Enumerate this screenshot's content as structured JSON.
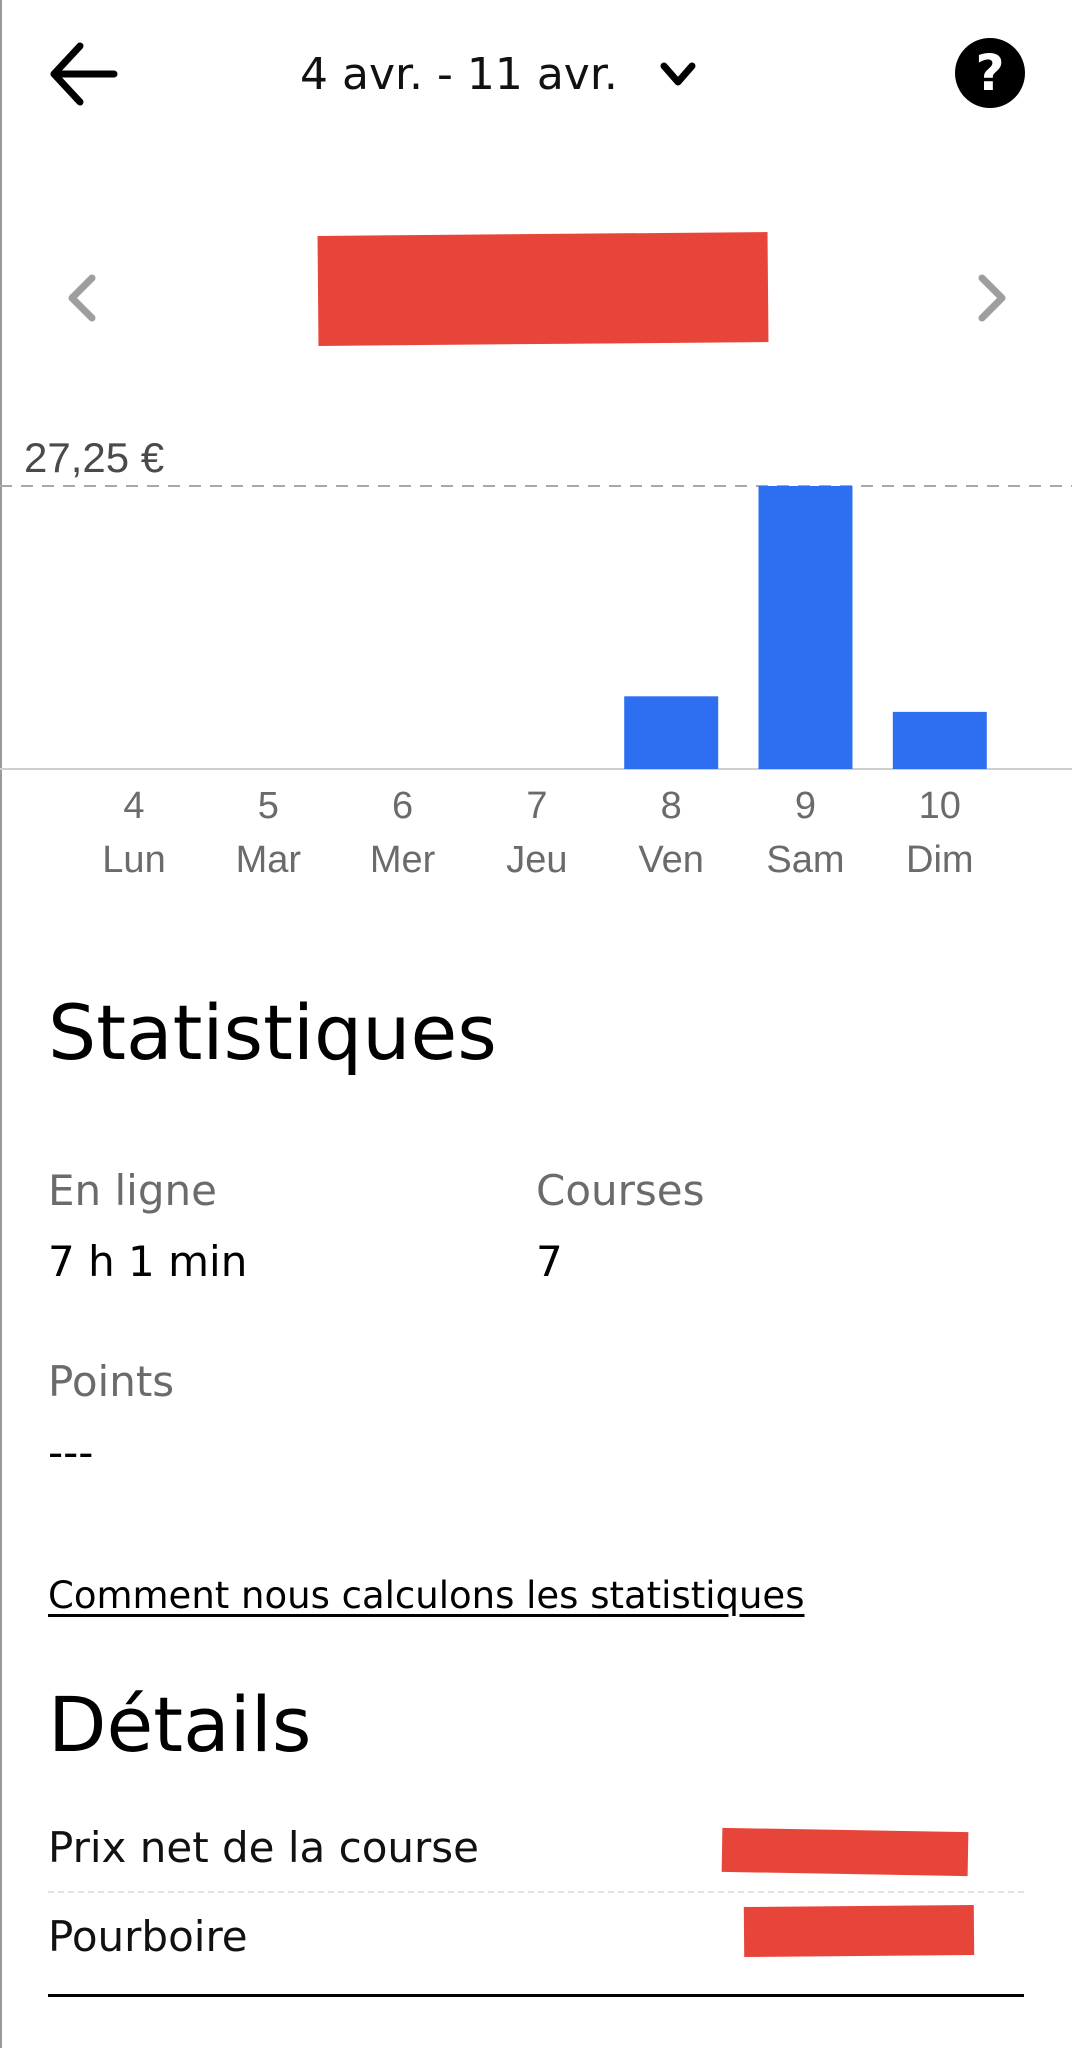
{
  "header": {
    "date_range": "4 avr. - 11 avr.",
    "back_icon": "arrow-left-icon",
    "dropdown_icon": "chevron-down-icon",
    "help_icon": "question-circle-icon",
    "help_glyph": "?"
  },
  "period_nav": {
    "prev_icon": "chevron-left-icon",
    "next_icon": "chevron-right-icon"
  },
  "chart_data": {
    "type": "bar",
    "categories": [
      "4",
      "5",
      "6",
      "7",
      "8",
      "9",
      "10"
    ],
    "day_names": [
      "Lun",
      "Mar",
      "Mer",
      "Jeu",
      "Ven",
      "Sam",
      "Dim"
    ],
    "values": [
      0,
      0,
      0,
      0,
      7.0,
      27.25,
      5.5
    ],
    "max_label": "27,25 €",
    "ylim": [
      0,
      27.25
    ],
    "bar_color": "#2d6ff0",
    "grid": false
  },
  "statistics": {
    "title": "Statistiques",
    "online_label": "En ligne",
    "online_value": "7 h 1 min",
    "trips_label": "Courses",
    "trips_value": "7",
    "points_label": "Points",
    "points_value": "---",
    "how_link": "Comment nous calculons les statistiques"
  },
  "details": {
    "title": "Détails",
    "rows": [
      {
        "label": "Prix net de la course"
      },
      {
        "label": "Pourboire"
      }
    ]
  },
  "colors": {
    "redaction": "#e8453a",
    "accent": "#2d6ff0",
    "muted_text": "#6b6b6b"
  }
}
